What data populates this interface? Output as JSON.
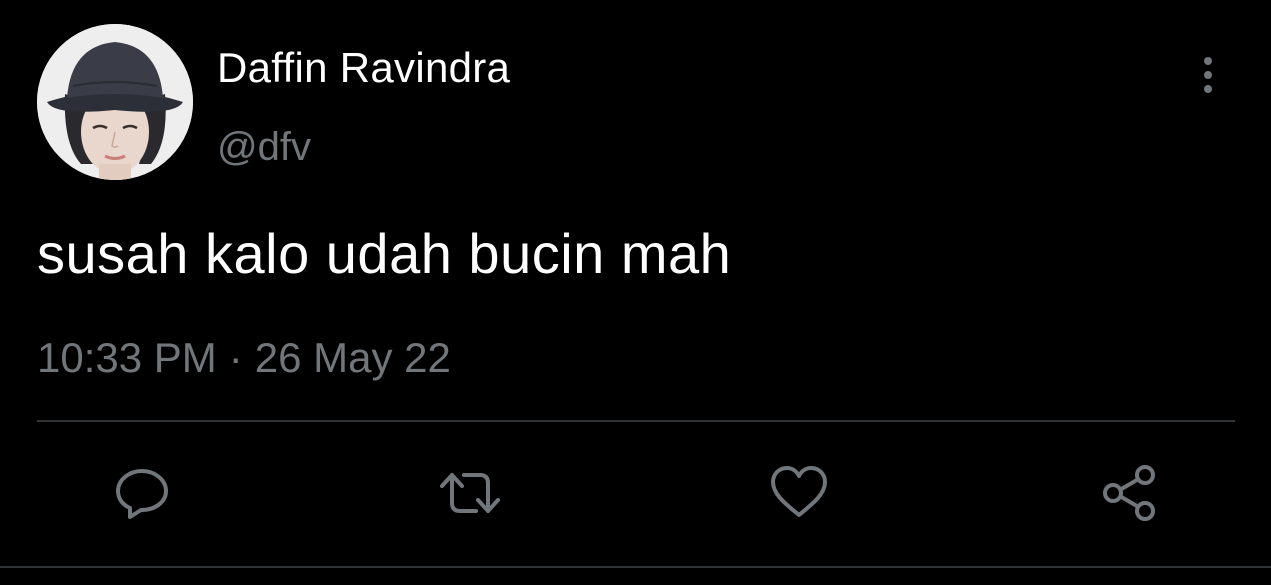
{
  "user": {
    "display_name": "Daffin Ravindra",
    "handle": "@dfv"
  },
  "tweet": {
    "text": "susah kalo udah bucin mah",
    "time": "10:33 PM",
    "separator": "·",
    "date": "26 May 22"
  },
  "icons": {
    "more": "more-vertical-icon",
    "reply": "reply-icon",
    "retweet": "retweet-icon",
    "like": "heart-icon",
    "share": "share-icon"
  },
  "colors": {
    "background": "#000000",
    "primary_text": "#ffffff",
    "secondary_text": "#71767b",
    "divider": "#2f3336"
  }
}
